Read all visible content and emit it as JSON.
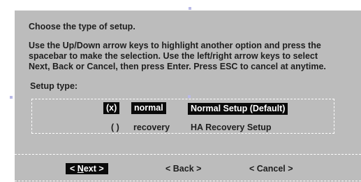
{
  "dialog": {
    "heading": "Choose the type of setup.",
    "instructions": [
      "Use the Up/Down arrow keys to highlight another option and press the",
      "spacebar to make the selection. Use the left/right arrow keys to select",
      "Next, Back or Cancel, then press Enter. Press ESC to cancel at anytime."
    ],
    "setup_type_label": "Setup type:"
  },
  "options": [
    {
      "marker": "(x)",
      "name": "normal",
      "description": "Normal Setup (Default)",
      "selected": true
    },
    {
      "marker": "( )",
      "name": "recovery",
      "description": "HA Recovery Setup",
      "selected": false
    }
  ],
  "buttons": {
    "next": {
      "prefix": "< ",
      "hotkey": "N",
      "rest": "ext",
      "suffix": " >",
      "focused": true
    },
    "back": {
      "label": "< Back >"
    },
    "cancel": {
      "label": "< Cancel >"
    }
  },
  "colors": {
    "panel_background": "#bcbcbc",
    "highlight_background": "#0a0a0a",
    "highlight_text": "#ffffff",
    "text": "#1e1e1e",
    "dashed_border": "#ffffff"
  }
}
